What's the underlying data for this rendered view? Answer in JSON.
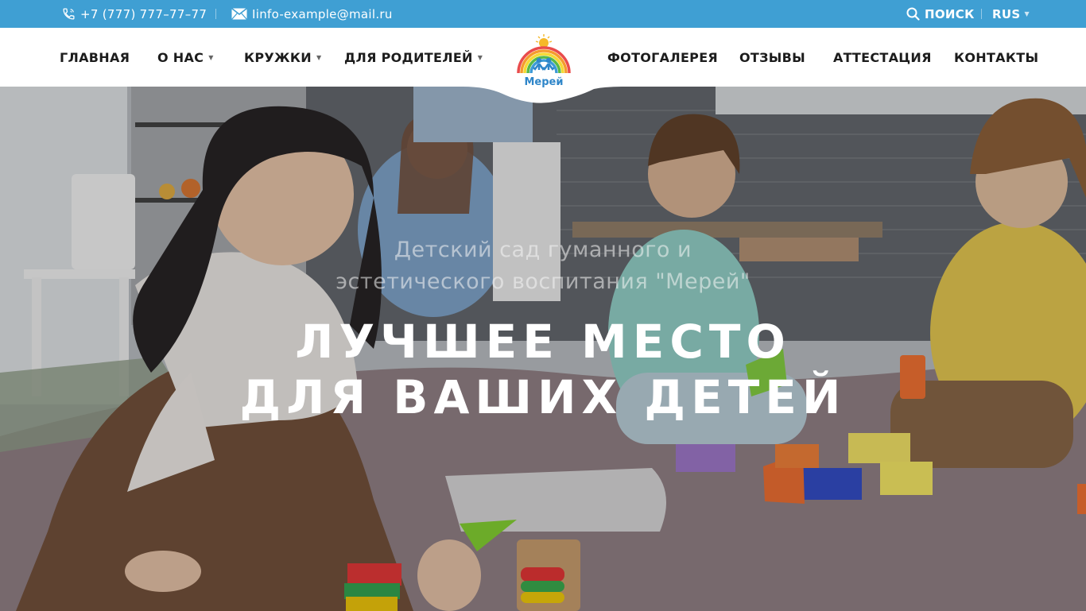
{
  "topbar": {
    "phone": "+7 (777) 777–77–77",
    "email": "Iinfo-example@mail.ru",
    "search_label": "ПОИСК",
    "language": "RUS",
    "bg_color": "#3f9fd3"
  },
  "nav": {
    "items": [
      {
        "label": "ГЛАВНАЯ"
      },
      {
        "label": "О НАС"
      },
      {
        "label": "КРУЖКИ"
      },
      {
        "label": "ДЛЯ РОДИТЕЛЕЙ"
      },
      {
        "label": "ФОТОГАЛЕРЕЯ"
      },
      {
        "label": "ОТЗЫВЫ"
      },
      {
        "label": "АТТЕСТАЦИЯ"
      },
      {
        "label": "КОНТАКТЫ"
      }
    ],
    "logo_text": "Мерей"
  },
  "hero": {
    "subtitle_line1": "Детский сад гуманного и",
    "subtitle_line2": "эстетического воспитания \"Мерей\"",
    "headline_line1": "ЛУЧШЕЕ МЕСТО",
    "headline_line2": "ДЛЯ ВАШИХ ДЕТЕЙ"
  },
  "icons": [
    "phone-icon",
    "mail-icon",
    "search-icon",
    "chevron-down-icon",
    "logo-rainbow-icon"
  ]
}
